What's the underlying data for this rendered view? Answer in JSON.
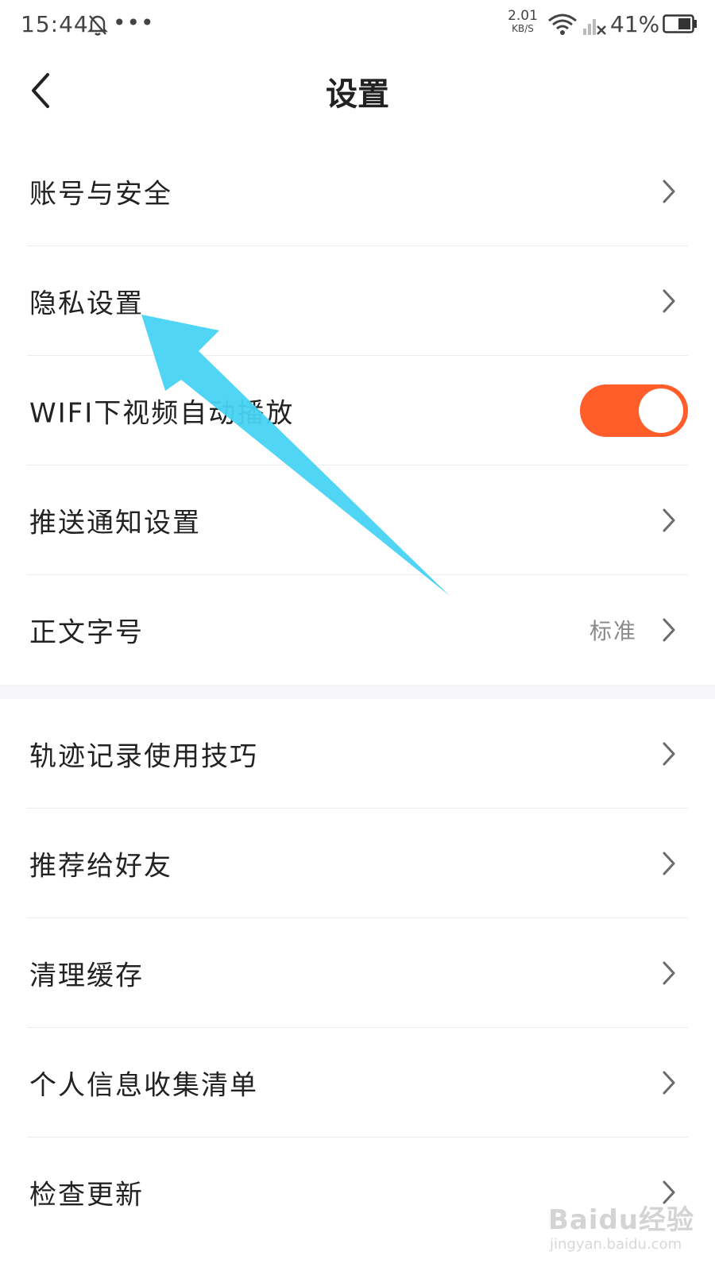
{
  "status_bar": {
    "time": "15:44",
    "dots": "•••",
    "speed_value": "2.01",
    "speed_unit": "KB/S",
    "battery": "41%",
    "icons": [
      "bell-muted-icon",
      "wifi-icon",
      "signal-off-icon",
      "battery-icon"
    ]
  },
  "header": {
    "title": "设置",
    "back_icon": "chevron-left-icon"
  },
  "settings": {
    "group1": [
      {
        "label": "账号与安全"
      },
      {
        "label": "隐私设置"
      },
      {
        "label": "WIFI下视频自动播放",
        "toggle_on": true
      },
      {
        "label": "推送通知设置"
      },
      {
        "label": "正文字号",
        "value": "标准"
      }
    ],
    "group2": [
      {
        "label": "轨迹记录使用技巧"
      },
      {
        "label": "推荐给好友"
      },
      {
        "label": "清理缓存"
      },
      {
        "label": "个人信息收集清单"
      },
      {
        "label": "检查更新"
      }
    ]
  },
  "colors": {
    "toggle_on": "#ff5d2a",
    "annotation_arrow": "#47d3f3",
    "chevron": "#6b6b6b"
  },
  "watermark": {
    "brand": "Baidu经验",
    "url": "jingyan.baidu.com"
  }
}
